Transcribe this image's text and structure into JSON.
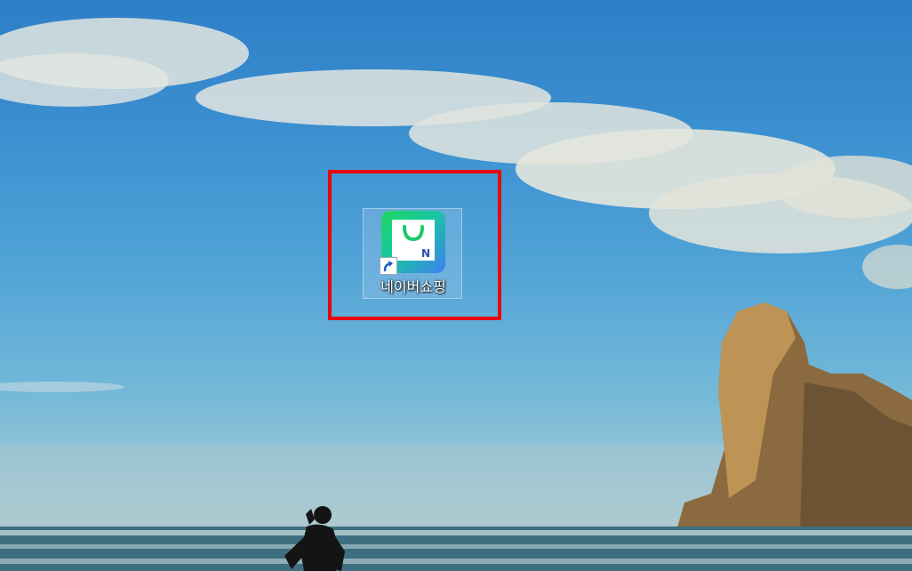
{
  "desktop": {
    "shortcut": {
      "label": "네이버쇼핑",
      "icon": "naver-shopping-bag-icon",
      "badge_icon": "shortcut-arrow-icon",
      "colors": {
        "green": "#1ed760",
        "blue": "#3d7ff0"
      }
    },
    "highlight": {
      "color": "#e8050d"
    }
  }
}
